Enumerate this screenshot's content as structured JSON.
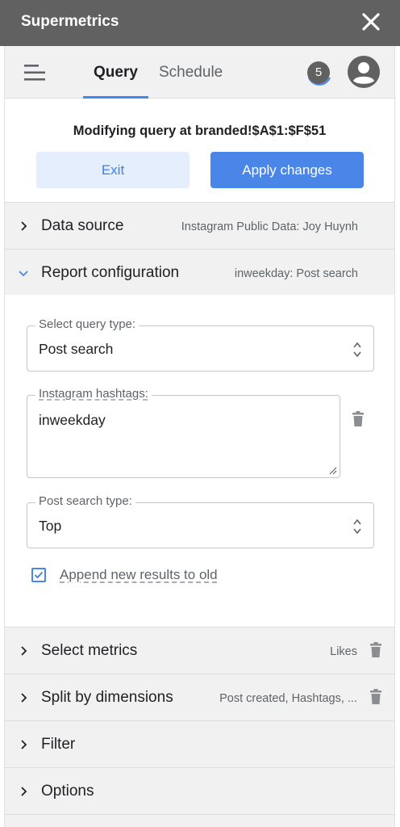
{
  "app": {
    "title": "Supermetrics"
  },
  "nav": {
    "tabs": [
      {
        "label": "Query",
        "active": true
      },
      {
        "label": "Schedule",
        "active": false
      }
    ],
    "badge_count": "5",
    "accent_color": "#4285f4"
  },
  "query_banner": {
    "text": "Modifying query at branded!$A$1:$F$51",
    "exit_label": "Exit",
    "apply_label": "Apply changes"
  },
  "sections": {
    "data_source": {
      "label": "Data source",
      "summary": "Instagram Public Data: Joy Huynh",
      "expanded": false
    },
    "report_configuration": {
      "label": "Report configuration",
      "summary": "inweekday: Post search",
      "expanded": true
    },
    "select_metrics": {
      "label": "Select metrics",
      "summary": "Likes",
      "expanded": false
    },
    "split_by_dimensions": {
      "label": "Split by dimensions",
      "summary": "Post created, Hashtags, ...",
      "expanded": false
    },
    "filter": {
      "label": "Filter",
      "expanded": false
    },
    "options": {
      "label": "Options",
      "expanded": false
    }
  },
  "report_config": {
    "query_type": {
      "label": "Select query type:",
      "value": "Post search"
    },
    "hashtags": {
      "label": "Instagram hashtags:",
      "value": "inweekday"
    },
    "post_search_type": {
      "label": "Post search type:",
      "value": "Top"
    },
    "append_results": {
      "label": "Append new results to old",
      "checked": true
    }
  },
  "icons": {
    "close": "close-icon",
    "menu": "hamburger-menu-icon",
    "avatar": "account-circle-icon",
    "trash": "trash-icon",
    "chevron_right": "chevron-right-icon",
    "chevron_down": "chevron-down-icon",
    "select_arrows": "up-down-arrows-icon",
    "checkbox": "checkbox-checked-icon"
  }
}
